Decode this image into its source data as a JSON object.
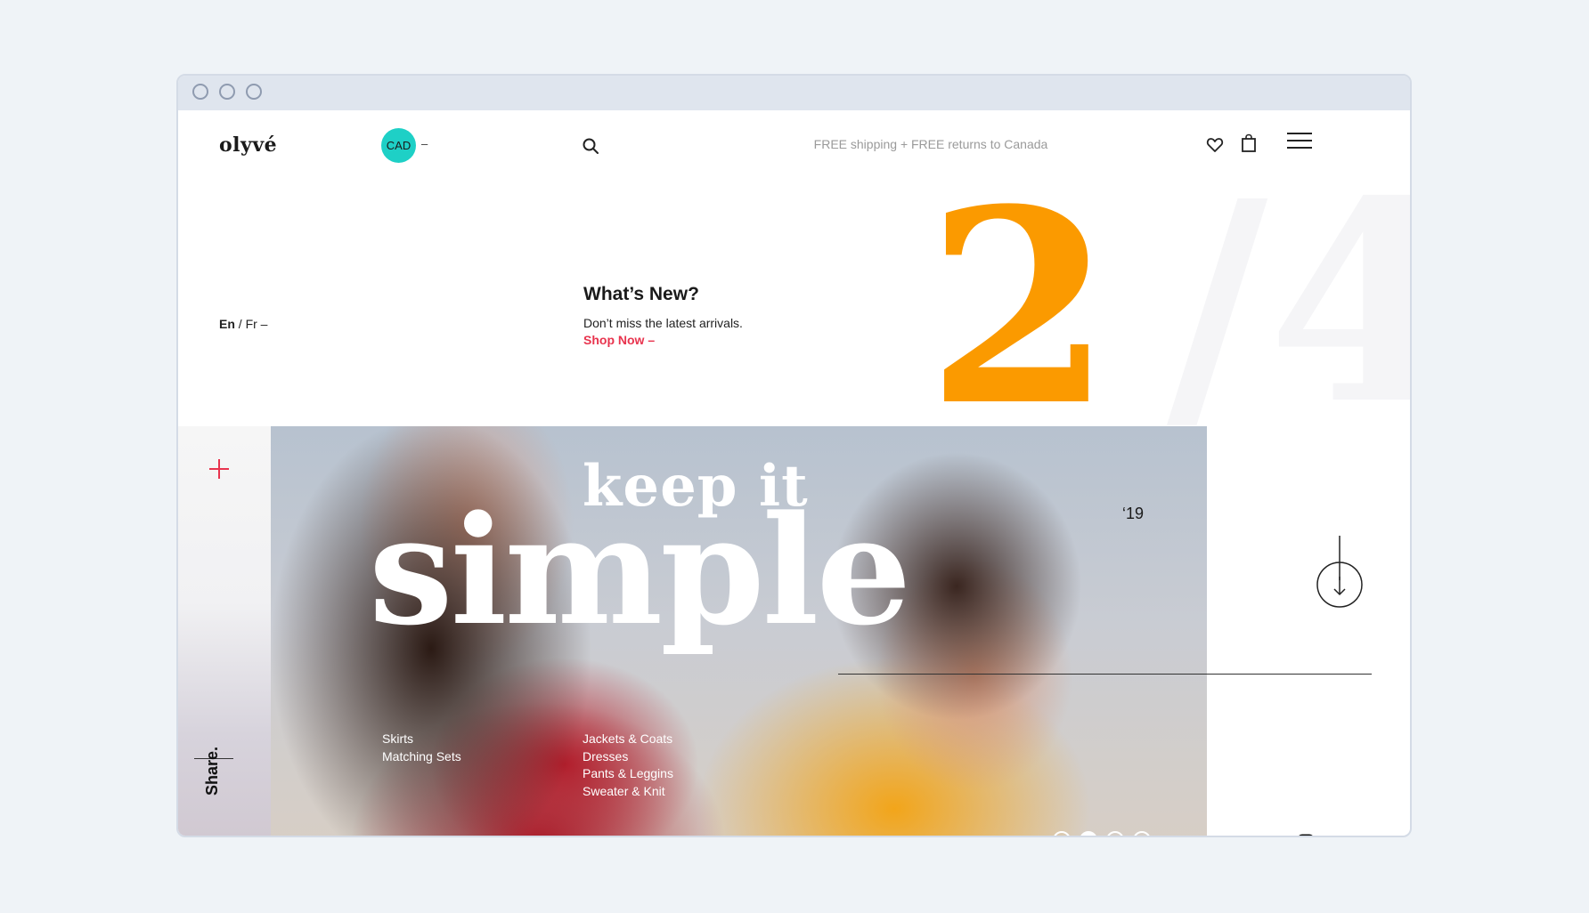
{
  "header": {
    "logo": "olyvé",
    "currency": "CAD",
    "currency_dash": "–",
    "shipping_notice": "FREE shipping + FREE returns to Canada",
    "icons": [
      "search-icon",
      "heart-icon",
      "bag-icon",
      "menu-icon"
    ]
  },
  "language": {
    "active": "En",
    "separator": " / ",
    "other": "Fr",
    "dash": " –"
  },
  "promo": {
    "title": "What’s New?",
    "text": "Don’t miss the latest arrivals.",
    "link": "Shop Now –"
  },
  "slide_counter": {
    "current": "2",
    "total": "/4"
  },
  "hero": {
    "line1": "keep it",
    "line2": "simple",
    "year": "‘19",
    "categories_left": [
      "Skirts",
      "Matching Sets"
    ],
    "categories_right": [
      "Jackets & Coats",
      "Dresses",
      "Pants & Leggins",
      "Sweater & Knit"
    ]
  },
  "sidebar": {
    "share": "Share."
  },
  "pager": {
    "count": 4,
    "active_index": 1
  },
  "colors": {
    "accent_orange": "#fb9a00",
    "accent_teal": "#1ed0c6",
    "accent_red": "#e8344e"
  }
}
